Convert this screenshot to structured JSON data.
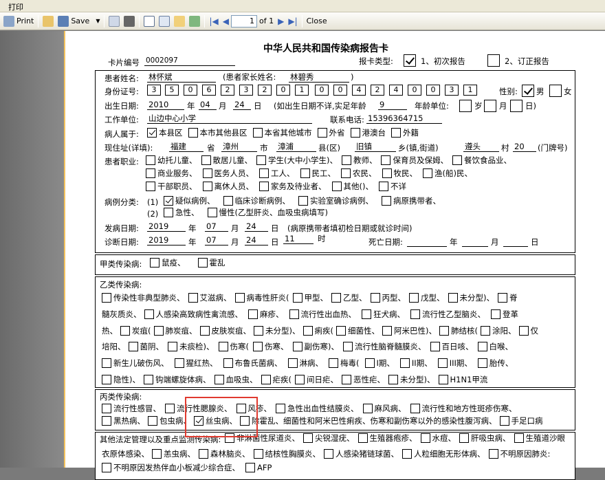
{
  "window": {
    "title": "打印"
  },
  "toolbar": {
    "print": "Print",
    "save": "Save",
    "page": "1",
    "of": "of 1",
    "close": "Close"
  },
  "card": {
    "title": "中华人民共和国传染病报告卡",
    "card_no_label": "卡片编号",
    "card_no": "0002097",
    "report_type_label": "报卡类型:",
    "first_report": "1、初次报告",
    "revised_report": "2、订正报告",
    "patient_name_label": "患者姓名:",
    "patient_name": "林怀斌",
    "parent_name_label": "(患者家长姓名:",
    "parent_name": "林碧秀",
    "parent_close": ")",
    "id_label": "身份证号:",
    "id_digits": [
      "3",
      "5",
      "0",
      "6",
      "2",
      "3",
      "2",
      "0",
      "1",
      "0",
      "0",
      "4",
      "2",
      "4",
      "0",
      "0",
      "3",
      "1"
    ],
    "sex_label": "性别:",
    "male": "男",
    "female": "女",
    "birth_label": "出生日期:",
    "birth_year": "2010",
    "year": "年",
    "birth_month": "04",
    "month": "月",
    "birth_day": "24",
    "day": "日",
    "age_note": "(如出生日期不详,实足年龄",
    "age": "9",
    "age_unit_label": "年龄单位:",
    "unit_year": "岁",
    "unit_month": "月",
    "unit_day": "日)",
    "work_label": "工作单位:",
    "work": "山边中心小学",
    "phone_label": "联系电话:",
    "phone": "15396364715",
    "belong_label": "病人属于:",
    "belong_options": [
      "本县区",
      "本市其他县区",
      "本省其他城市",
      "外省",
      "港澳台",
      "外籍"
    ],
    "address_label": "现住址(详填):",
    "province": "福建",
    "prov_u": "省",
    "city": "漳州",
    "city_u": "市",
    "county": "漳浦",
    "county_u": "县(区)",
    "town": "旧镇",
    "town_u": "乡(镇,街道)",
    "village": "遵头",
    "village_u": "村",
    "house": "20",
    "house_u": "(门牌号)",
    "occupation_label": "患者职业:",
    "occ_row1": [
      "幼托儿童、",
      "散居儿童、",
      "学生(大中小学生)、",
      "教师、",
      "保育员及保姆、",
      "餐饮食品业、"
    ],
    "occ_row2": [
      "商业服务、",
      "医务人员、",
      "工人、",
      "民工、",
      "农民、",
      "牧民、",
      "渔(船)民、"
    ],
    "occ_row3": [
      "干部职员、",
      "离休人员、",
      "家务及待业者、",
      "其他()、",
      "不详"
    ],
    "case_label": "病例分类:",
    "case1_prefix": "(1)",
    "case1": [
      "疑似病例、",
      "临床诊断病例、",
      "实验室确诊病例、",
      "病原携带者、"
    ],
    "case2_prefix": "(2)",
    "case2": [
      "急性、",
      "慢性(乙型肝炎、血吸虫病填写)"
    ],
    "onset_label": "发病日期:",
    "onset_year": "2019",
    "onset_month": "07",
    "onset_day": "24",
    "onset_note": "(病原携带者填初检日期或就诊时间)",
    "diag_label": "诊断日期:",
    "diag_year": "2019",
    "diag_month": "07",
    "diag_day": "24",
    "diag_hour": "11",
    "hour": "时",
    "death_label": "死亡日期:",
    "class_a_label": "甲类传染病:",
    "class_a": [
      "鼠疫、",
      "霍乱"
    ],
    "class_b_label": "乙类传染病:",
    "b_row1": [
      "传染性非典型肺炎、",
      "艾滋病、",
      "病毒性肝炎(",
      "甲型、",
      "乙型、",
      "丙型、",
      "戊型、",
      "未分型)、",
      "脊"
    ],
    "b_row2_lead": "髓灰质炎、",
    "b_row2": [
      "人感染高致病性禽流感、",
      "麻疹、",
      "流行性出血热、",
      "狂犬病、",
      "流行性乙型脑炎、",
      "登革"
    ],
    "b_row3_lead": "热、",
    "b_row3": [
      "炭疽(",
      "肺炭疽、",
      "皮肤炭疽、",
      "未分型)、",
      "痢疾(",
      "细菌性、",
      "阿米巴性)、",
      "肺结核(",
      "涂阳、",
      "仅"
    ],
    "b_row4_lead": "培阳、",
    "b_row4": [
      "菌阴、",
      "未痰检)、",
      "伤寒(",
      "伤寒、",
      "副伤寒)、",
      "流行性脑脊髓膜炎、",
      "百日咳、",
      "白喉、"
    ],
    "b_row5": [
      "新生儿破伤风、",
      "猩红热、",
      "布鲁氏菌病、",
      "淋病、",
      "梅毒(",
      "I期、",
      "II期、",
      "III期、",
      "胎传、"
    ],
    "b_row6": [
      "隐性)、",
      "钩端螺旋体病、",
      "血吸虫、",
      "疟疾(",
      "间日疟、",
      "恶性疟、",
      "未分型)、",
      "H1N1甲流"
    ],
    "class_c_label": "丙类传染病:",
    "c_row1": [
      "流行性感冒、",
      "流行性腮腺炎、",
      "风疹、",
      "急性出血性结膜炎、",
      "麻风病、",
      "流行性和地方性斑疹伤寒、"
    ],
    "c_row2": [
      "黑热病、",
      "包虫病、",
      "丝虫病、",
      "除霍乱、细菌性和阿米巴性痢疾、伤寒和副伤寒以外的感染性腹泻病、",
      "手足口病"
    ],
    "other_label": "其他法定管理以及重点监测传染病:",
    "o_row1": [
      "非淋菌性尿道炎、",
      "尖锐湿疣、",
      "生殖器疱疹、",
      "水痘、",
      "肝吸虫病、",
      "生殖道沙眼"
    ],
    "o_row2_lead": "衣原体感染、",
    "o_row2": [
      "恙虫病、",
      "森林脑炎、",
      "结核性胸膜炎、",
      "人感染猪链球菌、",
      "人粒细胞无形体病、",
      "不明原因肺炎:"
    ],
    "o_row3": [
      "不明原因发热伴血小板减少综合症、",
      "AFP"
    ]
  }
}
